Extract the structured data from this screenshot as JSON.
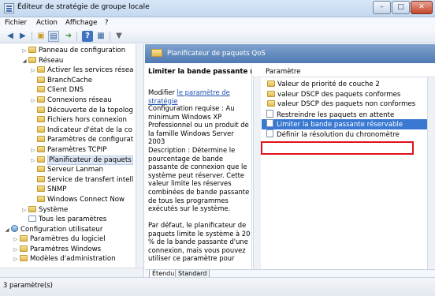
{
  "window": {
    "title": "Éditeur de stratégie de groupe locale",
    "controls": {
      "minimize": "–",
      "maximize": "□",
      "close": "✕"
    }
  },
  "menu": {
    "items": [
      "Fichier",
      "Action",
      "Affichage",
      "?"
    ]
  },
  "toolbar": {
    "buttons": [
      "back-icon",
      "forward-icon",
      "up-icon",
      "show-tree-icon",
      "export-icon",
      "help-icon",
      "properties-icon",
      "filter-icon"
    ]
  },
  "tree": {
    "rows": [
      {
        "label": "Panneau de configuration",
        "indent": 3,
        "toggle": "▷",
        "icon": "folder"
      },
      {
        "label": "Réseau",
        "indent": 3,
        "toggle": "◢",
        "icon": "folder"
      },
      {
        "label": "Activer les services résea",
        "indent": 4,
        "toggle": "▷",
        "icon": "folder"
      },
      {
        "label": "BranchCache",
        "indent": 4,
        "toggle": "",
        "icon": "folder"
      },
      {
        "label": "Client DNS",
        "indent": 4,
        "toggle": "",
        "icon": "folder"
      },
      {
        "label": "Connexions réseau",
        "indent": 4,
        "toggle": "▷",
        "icon": "folder"
      },
      {
        "label": "Découverte de la topolog",
        "indent": 4,
        "toggle": "",
        "icon": "folder"
      },
      {
        "label": "Fichiers hors connexion",
        "indent": 4,
        "toggle": "",
        "icon": "folder"
      },
      {
        "label": "Indicateur d'état de la co",
        "indent": 4,
        "toggle": "",
        "icon": "folder"
      },
      {
        "label": "Paramètres de configurat",
        "indent": 4,
        "toggle": "",
        "icon": "folder"
      },
      {
        "label": "Paramètres TCPIP",
        "indent": 4,
        "toggle": "▷",
        "icon": "folder"
      },
      {
        "label": "Planificateur de paquets",
        "indent": 4,
        "toggle": "▷",
        "icon": "folder",
        "selected": true
      },
      {
        "label": "Serveur Lanman",
        "indent": 4,
        "toggle": "",
        "icon": "folder"
      },
      {
        "label": "Service de transfert intell",
        "indent": 4,
        "toggle": "",
        "icon": "folder"
      },
      {
        "label": "SNMP",
        "indent": 4,
        "toggle": "",
        "icon": "folder"
      },
      {
        "label": "Windows Connect Now",
        "indent": 4,
        "toggle": "",
        "icon": "folder"
      },
      {
        "label": "Système",
        "indent": 3,
        "toggle": "▷",
        "icon": "folder"
      },
      {
        "label": "Tous les paramètres",
        "indent": 3,
        "toggle": "",
        "icon": "plain"
      },
      {
        "label": "Configuration utilisateur",
        "indent": 1,
        "toggle": "◢",
        "icon": "net"
      },
      {
        "label": "Paramètres du logiciel",
        "indent": 2,
        "toggle": "▷",
        "icon": "folder"
      },
      {
        "label": "Paramètres Windows",
        "indent": 2,
        "toggle": "▷",
        "icon": "folder"
      },
      {
        "label": "Modèles d'administration",
        "indent": 2,
        "toggle": "▷",
        "icon": "folder"
      }
    ]
  },
  "header": {
    "title": "Planificateur de paquets QoS"
  },
  "description": {
    "title": "Limiter la bande passante réservable",
    "modify_prefix": "Modifier ",
    "modify_link": "le paramètre de stratégie",
    "requirements": "Configuration requise : Au minimum Windows XP Professionnel ou un produit de la famille Windows Server 2003",
    "description": "Description : Détermine le pourcentage de bande passante de connexion que le système peut réserver. Cette valeur limite les réserves combinées de bande passante de tous les programmes exécutés sur le système.",
    "default": "Par défaut, le planificateur de paquets limite le système à 20 % de la bande passante d'une connexion, mais vous pouvez utiliser ce paramètre pour"
  },
  "list": {
    "column_header": "Paramètre",
    "rows": [
      {
        "label": "Valeur de priorité de couche 2",
        "icon": "folder"
      },
      {
        "label": "valeur DSCP des paquets conformes",
        "icon": "folder"
      },
      {
        "label": "valeur DSCP des paquets non conformes",
        "icon": "folder"
      },
      {
        "label": "Restreindre les paquets en attente",
        "icon": "policy"
      },
      {
        "label": "Limiter la bande passante réservable",
        "icon": "policy",
        "selected": true
      },
      {
        "label": "Définir la résolution du chronomètre",
        "icon": "policy"
      }
    ]
  },
  "tabs": {
    "extended": "Étendu",
    "standard": "Standard"
  },
  "status": {
    "text": "3 paramètre(s)"
  },
  "colors": {
    "selection": "#3a79d2",
    "highlight_box": "#e2111b",
    "header": "#5a84bb"
  }
}
